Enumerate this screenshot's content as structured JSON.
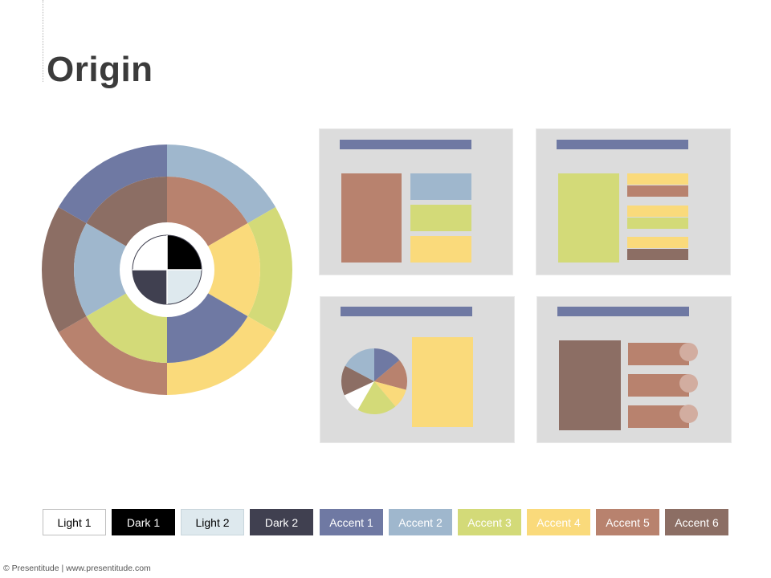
{
  "slide": {
    "title": "Origin",
    "footer": "© Presentitude | www.presentitude.com"
  },
  "colors": {
    "light1": "#ffffff",
    "dark1": "#000000",
    "light2": "#dee9ee",
    "dark2": "#404050",
    "accent1": "#6f79a3",
    "accent2": "#9fb7cd",
    "accent3": "#d3da78",
    "accent4": "#fada7b",
    "accent5": "#b8826e",
    "accent6": "#8c6e64",
    "thumb_bg": "#dcdcdc"
  },
  "swatches": [
    {
      "label": "Light 1",
      "bg": "#ffffff",
      "fg": "#000000",
      "border": "#bfbfbf"
    },
    {
      "label": "Dark 1",
      "bg": "#000000",
      "fg": "#ffffff",
      "border": "#000000"
    },
    {
      "label": "Light 2",
      "bg": "#dee9ee",
      "fg": "#000000",
      "border": "#c9d6dc"
    },
    {
      "label": "Dark 2",
      "bg": "#404050",
      "fg": "#ffffff",
      "border": "#404050"
    },
    {
      "label": "Accent 1",
      "bg": "#6f79a3",
      "fg": "#ffffff",
      "border": "#6f79a3"
    },
    {
      "label": "Accent 2",
      "bg": "#9fb7cd",
      "fg": "#ffffff",
      "border": "#9fb7cd"
    },
    {
      "label": "Accent 3",
      "bg": "#d3da78",
      "fg": "#ffffff",
      "border": "#d3da78"
    },
    {
      "label": "Accent 4",
      "bg": "#fada7b",
      "fg": "#ffffff",
      "border": "#fada7b"
    },
    {
      "label": "Accent 5",
      "bg": "#b8826e",
      "fg": "#ffffff",
      "border": "#b8826e"
    },
    {
      "label": "Accent 6",
      "bg": "#8c6e64",
      "fg": "#ffffff",
      "border": "#8c6e64"
    }
  ]
}
